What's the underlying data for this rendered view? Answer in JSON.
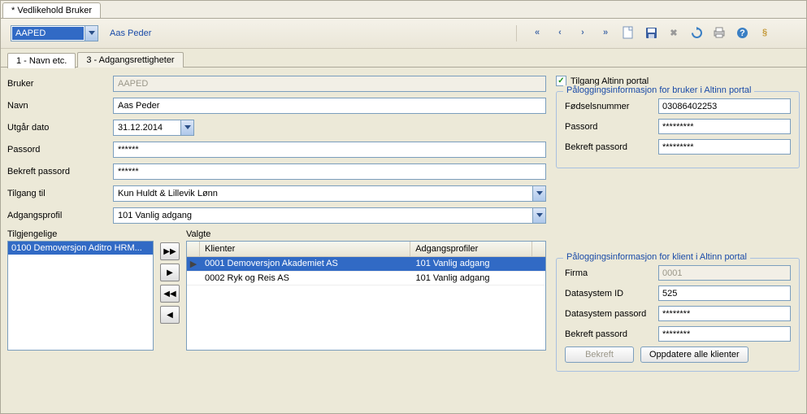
{
  "window_title": "* Vedlikehold Bruker",
  "user_combo": "AAPED",
  "user_name_link": "Aas Peder",
  "tabs": {
    "t1": "1 - Navn etc.",
    "t3": "3 - Adgangsrettigheter"
  },
  "form": {
    "labels": {
      "bruker": "Bruker",
      "navn": "Navn",
      "utgar_dato": "Utgår dato",
      "passord": "Passord",
      "bekreft_passord": "Bekreft passord",
      "tilgang_til": "Tilgang til",
      "adgangsprofil": "Adgangsprofil"
    },
    "values": {
      "bruker": "AAPED",
      "navn": "Aas Peder",
      "utgar_dato": "31.12.2014",
      "passord": "******",
      "bekreft_passord": "******",
      "tilgang_til": "Kun Huldt & Lillevik Lønn",
      "adgangsprofil": "101 Vanlig adgang"
    }
  },
  "altinn_checkbox_label": "Tilgang Altinn portal",
  "altinn_bruker": {
    "legend": "Påloggingsinformasjon for bruker i Altinn portal",
    "labels": {
      "fodselsnummer": "Fødselsnummer",
      "passord": "Passord",
      "bekreft_passord": "Bekreft passord"
    },
    "values": {
      "fodselsnummer": "03086402253",
      "passord": "*********",
      "bekreft_passord": "*********"
    }
  },
  "altinn_klient": {
    "legend": "Påloggingsinformasjon for klient i Altinn portal",
    "labels": {
      "firma": "Firma",
      "datasystem_id": "Datasystem ID",
      "datasystem_passord": "Datasystem passord",
      "bekreft_passord": "Bekreft passord"
    },
    "values": {
      "firma": "0001",
      "datasystem_id": "525",
      "datasystem_passord": "********",
      "bekreft_passord": "********"
    },
    "buttons": {
      "bekreft": "Bekreft",
      "oppdatere": "Oppdatere alle klienter"
    }
  },
  "lists": {
    "tilgjengelige_label": "Tilgjengelige",
    "valgte_label": "Valgte",
    "tilgjengelige": [
      "0100 Demoversjon Aditro HRM..."
    ],
    "grid_headers": {
      "klienter": "Klienter",
      "adgangsprofiler": "Adgangsprofiler"
    },
    "valgte": [
      {
        "klient": "0001 Demoversjon Akademiet AS",
        "profil": "101 Vanlig adgang",
        "selected": true
      },
      {
        "klient": "0002 Ryk og Reis AS",
        "profil": "101 Vanlig adgang",
        "selected": false
      }
    ]
  }
}
